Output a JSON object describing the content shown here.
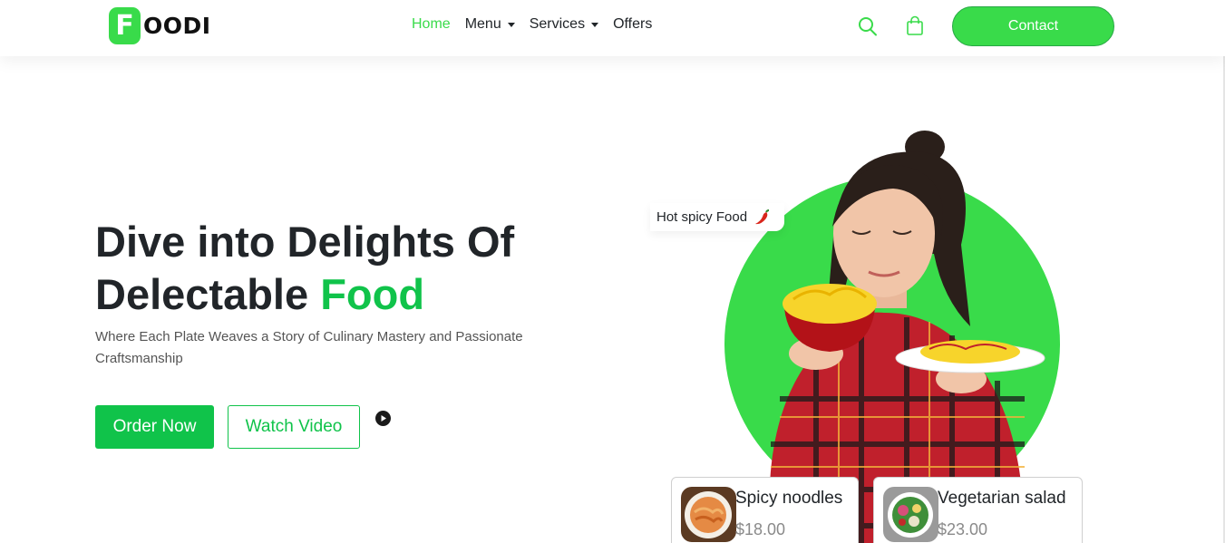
{
  "brand": {
    "logo_letter": "F",
    "logo_rest": "OODI",
    "accent_color": "#39db4a",
    "button_green": "#10c34a"
  },
  "nav": {
    "items": [
      {
        "label": "Home",
        "active": true,
        "dropdown": false
      },
      {
        "label": "Menu",
        "active": false,
        "dropdown": true
      },
      {
        "label": "Services",
        "active": false,
        "dropdown": true
      },
      {
        "label": "Offers",
        "active": false,
        "dropdown": false
      }
    ],
    "icons": [
      "search-icon",
      "shopping-bag-icon"
    ],
    "contact_label": "Contact"
  },
  "hero": {
    "title_line1": "Dive into Delights Of",
    "title_line2_prefix": "Delectable",
    "title_accent": "Food",
    "subtitle": "Where Each Plate Weaves a Story of Culinary Mastery and Passionate Craftsmanship",
    "order_label": "Order Now",
    "watch_label": "Watch Video"
  },
  "tag": {
    "label": "Hot spicy Food",
    "icon": "chili-pepper-icon"
  },
  "cards": [
    {
      "name": "Spicy noodles",
      "price": "$18.00"
    },
    {
      "name": "Vegetarian salad",
      "price": "$23.00"
    }
  ]
}
